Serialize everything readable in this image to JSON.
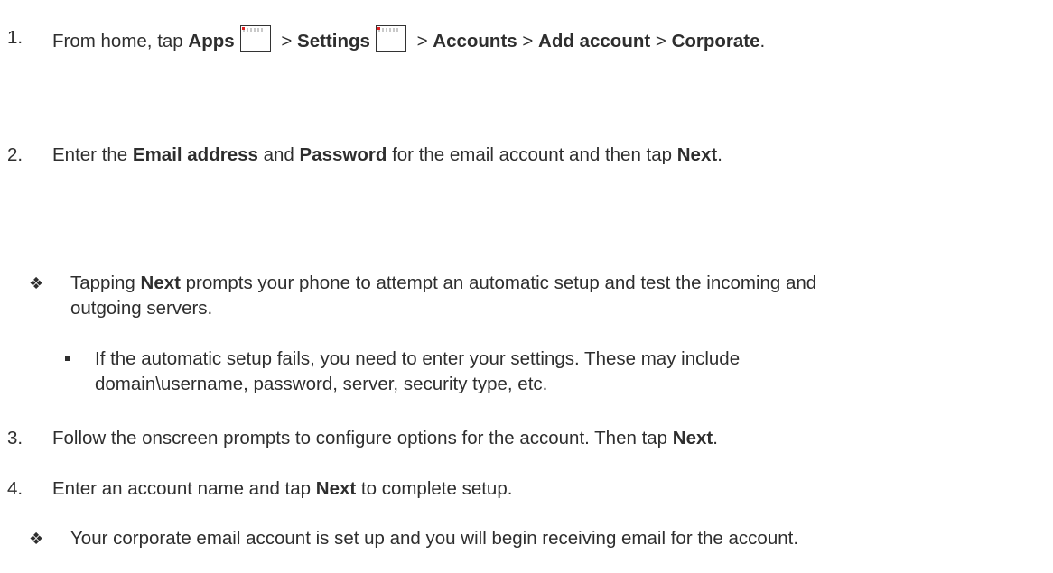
{
  "step1": {
    "num": "1.",
    "prefix": "From home, tap ",
    "apps": "Apps",
    "sep1": " > ",
    "settings": "Settings",
    "sep2": " > ",
    "accounts": "Accounts",
    "sep3": " > ",
    "add_account": "Add account",
    "sep4": " > ",
    "corporate": "Corporate",
    "end": "."
  },
  "step2": {
    "num": "2.",
    "prefix": "Enter the ",
    "email": "Email address",
    "mid1": " and ",
    "password": "Password",
    "mid2": " for the email account and then tap ",
    "next": "Next",
    "end": "."
  },
  "note1": {
    "bullet": "❖",
    "prefix": "Tapping ",
    "next": "Next",
    "line1_rest": " prompts your phone to attempt an automatic setup and test the incoming and",
    "line2": "outgoing servers."
  },
  "subnote1": {
    "line1": "If the automatic setup fails, you need to enter your settings. These may include",
    "line2": "domain\\username, password, server, security type, etc."
  },
  "step3": {
    "num": "3.",
    "text": "Follow the onscreen prompts to configure options for the account. Then tap ",
    "next": "Next",
    "end": "."
  },
  "step4": {
    "num": "4.",
    "prefix": "Enter an account name and tap ",
    "next": "Next",
    "rest": " to complete setup."
  },
  "note2": {
    "bullet": "❖",
    "text": "Your corporate email account is set up and you will begin receiving email for the account."
  }
}
